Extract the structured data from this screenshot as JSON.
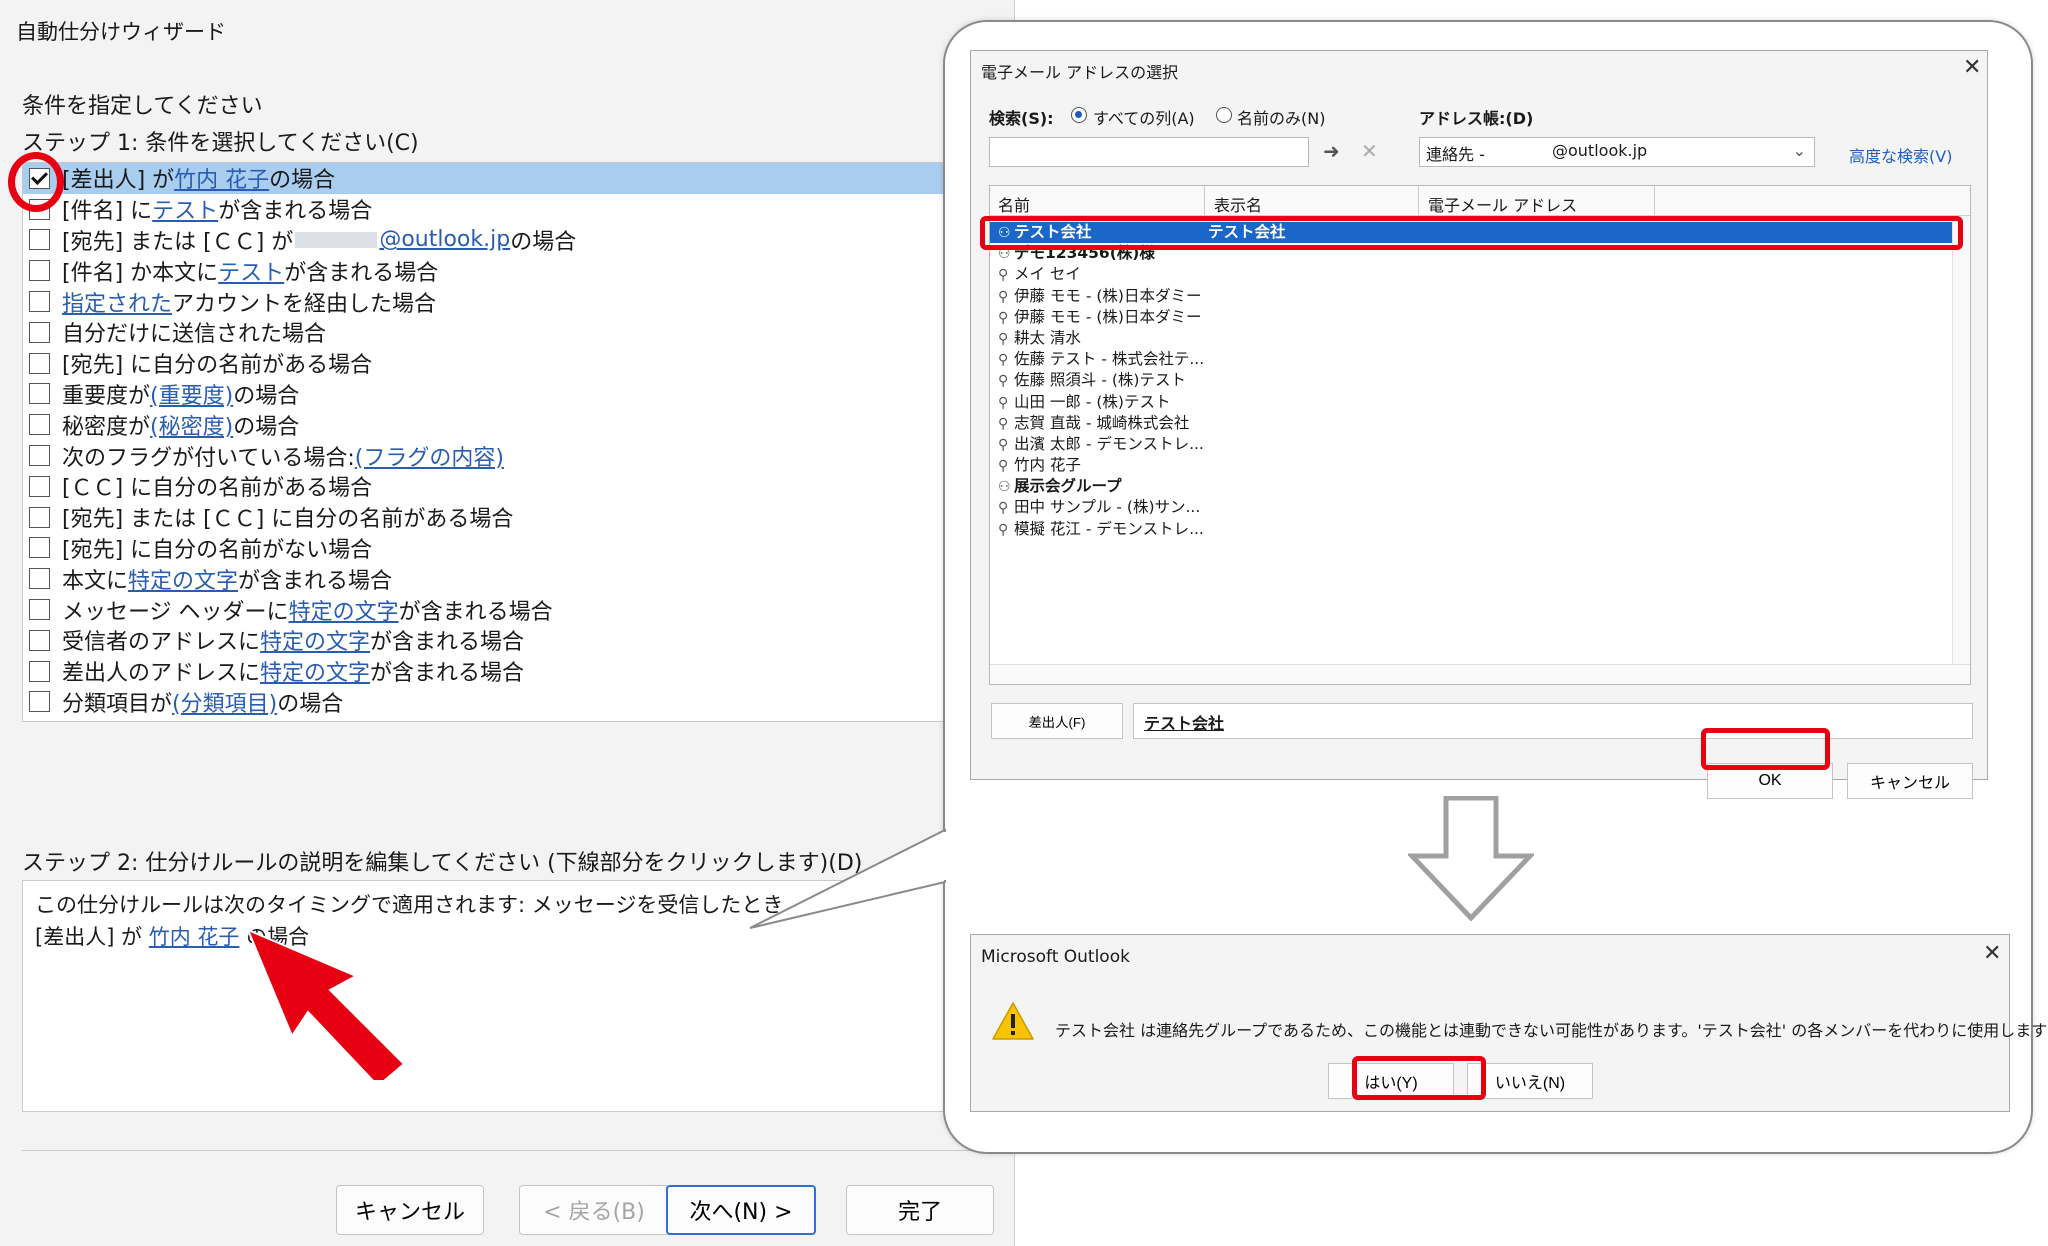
{
  "wizard": {
    "title": "自動仕分けウィザード",
    "prompt": "条件を指定してください",
    "step1": "ステップ 1: 条件を選択してください(C)",
    "conditions": [
      {
        "checked": true,
        "selected": true,
        "pre": "[差出人] が ",
        "link": "竹内 花子",
        "post": " の場合"
      },
      {
        "checked": false,
        "pre": "[件名] に ",
        "link": "テスト",
        "post": " が含まれる場合"
      },
      {
        "checked": false,
        "pre": "[宛先] または [ＣＣ] が ",
        "blur": true,
        "link": "@outlook.jp",
        "post": " の場合"
      },
      {
        "checked": false,
        "pre": "[件名] か本文に ",
        "link": "テスト",
        "post": " が含まれる場合"
      },
      {
        "checked": false,
        "pre": "",
        "link": "指定された",
        "post": " アカウントを経由した場合"
      },
      {
        "checked": false,
        "pre": "自分だけに送信された場合",
        "link": "",
        "post": ""
      },
      {
        "checked": false,
        "pre": "[宛先] に自分の名前がある場合",
        "link": "",
        "post": ""
      },
      {
        "checked": false,
        "pre": "重要度が ",
        "link": "(重要度)",
        "post": " の場合"
      },
      {
        "checked": false,
        "pre": "秘密度が ",
        "link": "(秘密度)",
        "post": " の場合"
      },
      {
        "checked": false,
        "pre": "次のフラグが付いている場合: ",
        "link": "(フラグの内容)",
        "post": ""
      },
      {
        "checked": false,
        "pre": "[ＣＣ] に自分の名前がある場合",
        "link": "",
        "post": ""
      },
      {
        "checked": false,
        "pre": "[宛先] または [ＣＣ] に自分の名前がある場合",
        "link": "",
        "post": ""
      },
      {
        "checked": false,
        "pre": "[宛先] に自分の名前がない場合",
        "link": "",
        "post": ""
      },
      {
        "checked": false,
        "pre": "本文に ",
        "link": "特定の文字",
        "post": " が含まれる場合"
      },
      {
        "checked": false,
        "pre": "メッセージ ヘッダーに ",
        "link": "特定の文字",
        "post": " が含まれる場合"
      },
      {
        "checked": false,
        "pre": "受信者のアドレスに ",
        "link": "特定の文字",
        "post": " が含まれる場合"
      },
      {
        "checked": false,
        "pre": "差出人のアドレスに ",
        "link": "特定の文字",
        "post": " が含まれる場合"
      },
      {
        "checked": false,
        "pre": "分類項目が ",
        "link": "(分類項目)",
        "post": " の場合"
      }
    ],
    "step2": "ステップ 2: 仕分けルールの説明を編集してください (下線部分をクリックします)(D)",
    "desc_line1": "この仕分けルールは次のタイミングで適用されます: メッセージを受信したとき",
    "desc_line2_pre": "[差出人] が ",
    "desc_line2_link": "竹内 花子",
    "desc_line2_post": " の場合",
    "buttons": {
      "cancel": "キャンセル",
      "back": "< 戻る(B)",
      "next": "次へ(N) >",
      "finish": "完了"
    }
  },
  "address_dialog": {
    "title": "電子メール アドレスの選択",
    "search_label": "検索(S):",
    "radio_all": "すべての列(A)",
    "radio_name": "名前のみ(N)",
    "book_label": "アドレス帳:(D)",
    "book_value_prefix": "連絡先 -",
    "book_value_suffix": "@outlook.jp",
    "advanced_search": "高度な検索(V)",
    "columns": [
      "名前",
      "表示名",
      "電子メール アドレス"
    ],
    "rows": [
      {
        "name": "テスト会社",
        "display": "テスト会社",
        "group": true,
        "highlight": true
      },
      {
        "name": "デモ123456(株)様",
        "display": "",
        "group": true,
        "bold": true
      },
      {
        "name": "メイ セイ",
        "display": ""
      },
      {
        "name": "伊藤 モモ - (株)日本ダミー",
        "display": ""
      },
      {
        "name": "伊藤 モモ - (株)日本ダミー",
        "display": ""
      },
      {
        "name": "耕太 清水",
        "display": ""
      },
      {
        "name": "佐藤 テスト - 株式会社テ...",
        "display": ""
      },
      {
        "name": "佐藤 照須斗 - (株)テスト",
        "display": ""
      },
      {
        "name": "山田 一郎 - (株)テスト",
        "display": ""
      },
      {
        "name": "志賀 直哉 - 城崎株式会社",
        "display": ""
      },
      {
        "name": "出濱 太郎 - デモンストレ...",
        "display": ""
      },
      {
        "name": "竹内 花子",
        "display": ""
      },
      {
        "name": "展示会グループ",
        "display": "",
        "group": true,
        "bold": true
      },
      {
        "name": "田中 サンプル - (株)サン...",
        "display": ""
      },
      {
        "name": "模擬 花江 - デモンストレ...",
        "display": ""
      }
    ],
    "from_button": "差出人(F)",
    "from_value": "テスト会社",
    "ok": "OK",
    "cancel": "キャンセル"
  },
  "outlook_dialog": {
    "title": "Microsoft Outlook",
    "message": "テスト会社 は連絡先グループであるため、この機能とは連動できない可能性があります。'テスト会社' の各メンバーを代わりに使用しますか?",
    "yes": "はい(Y)",
    "no": "いいえ(N)"
  },
  "colors": {
    "accent_red": "#e60012",
    "selection_blue": "#1a66c9",
    "list_selection": "#a9cdee",
    "link": "#2a5db0"
  }
}
